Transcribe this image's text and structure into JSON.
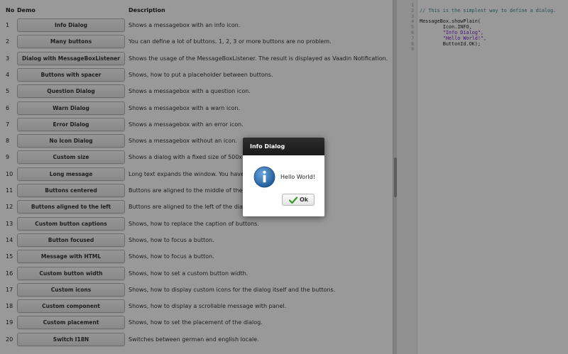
{
  "table": {
    "headers": {
      "no": "No",
      "demo": "Demo",
      "description": "Description"
    },
    "rows": [
      {
        "no": "1",
        "button": "Info Dialog",
        "desc": "Shows a messagebox with an info icon."
      },
      {
        "no": "2",
        "button": "Many buttons",
        "desc": "You can define a lot of buttons. 1, 2, 3 or more buttons are no problem."
      },
      {
        "no": "3",
        "button": "Dialog with MessageBoxListener",
        "desc": "Shows the usage of the MessageBoxListener. The result is displayed as Vaadin Notification."
      },
      {
        "no": "4",
        "button": "Buttons with spacer",
        "desc": "Shows, how to put a placeholder between buttons."
      },
      {
        "no": "5",
        "button": "Question Dialog",
        "desc": "Shows a messagebox with a question icon."
      },
      {
        "no": "6",
        "button": "Warn Dialog",
        "desc": "Shows a messagebox with a warn icon."
      },
      {
        "no": "7",
        "button": "Error Dialog",
        "desc": "Shows a messagebox with an error icon."
      },
      {
        "no": "8",
        "button": "No Icon Dialog",
        "desc": "Shows a messagebox without an icon."
      },
      {
        "no": "9",
        "button": "Custom size",
        "desc": "Shows a dialog with a fixed size of 500x"
      },
      {
        "no": "10",
        "button": "Long message",
        "desc": "Long text expands the window. You have                                    force line breaks."
      },
      {
        "no": "11",
        "button": "Buttons centered",
        "desc": "Buttons are aligned to the middle of the d"
      },
      {
        "no": "12",
        "button": "Buttons aligned to the left",
        "desc": "Buttons are aligned to the left of the dialo"
      },
      {
        "no": "13",
        "button": "Custom button captions",
        "desc": "Shows, how to replace the caption of buttons."
      },
      {
        "no": "14",
        "button": "Button focused",
        "desc": "Shows, how to focus a button."
      },
      {
        "no": "15",
        "button": "Message with HTML",
        "desc": "Shows, how to focus a button."
      },
      {
        "no": "16",
        "button": "Custom button width",
        "desc": "Shows, how to set a custom button width."
      },
      {
        "no": "17",
        "button": "Custom icons",
        "desc": "Shows, how to display custom icons for the dialog itself and the buttons."
      },
      {
        "no": "18",
        "button": "Custom component",
        "desc": "Shows, how to display a scrollable message with panel."
      },
      {
        "no": "19",
        "button": "Custom placement",
        "desc": "Shows, how to set the placement of the dialog."
      },
      {
        "no": "20",
        "button": "Switch I18N",
        "desc": "Switches between german and english locale."
      }
    ]
  },
  "code": {
    "line_numbers": [
      "1",
      "2",
      "3",
      "4",
      "5",
      "6",
      "7",
      "8",
      "9"
    ],
    "lines": [
      {
        "text": "",
        "cls": ""
      },
      {
        "text": "// This is the simplest way to define a dialog.",
        "cls": "c-comment"
      },
      {
        "text": "",
        "cls": ""
      },
      {
        "text": "MessageBox.showPlain(",
        "cls": ""
      },
      {
        "text": "        Icon.INFO,",
        "cls": ""
      },
      {
        "text": "        \"Info Dialog\",",
        "cls": "c-str"
      },
      {
        "text": "        \"Hello World!\",",
        "cls": "c-str"
      },
      {
        "text": "        ButtonId.OK);",
        "cls": ""
      },
      {
        "text": "",
        "cls": ""
      }
    ]
  },
  "dialog": {
    "title": "Info Dialog",
    "message": "Hello World!",
    "icon": "info-icon",
    "ok_label": "Ok",
    "ok_icon": "checkmark-icon"
  },
  "colors": {
    "overlay": "rgba(0,0,0,0.40)",
    "title_bar": "#1f1f1f",
    "info_icon": "#2f6fb0",
    "check": "#3a9a2a"
  }
}
